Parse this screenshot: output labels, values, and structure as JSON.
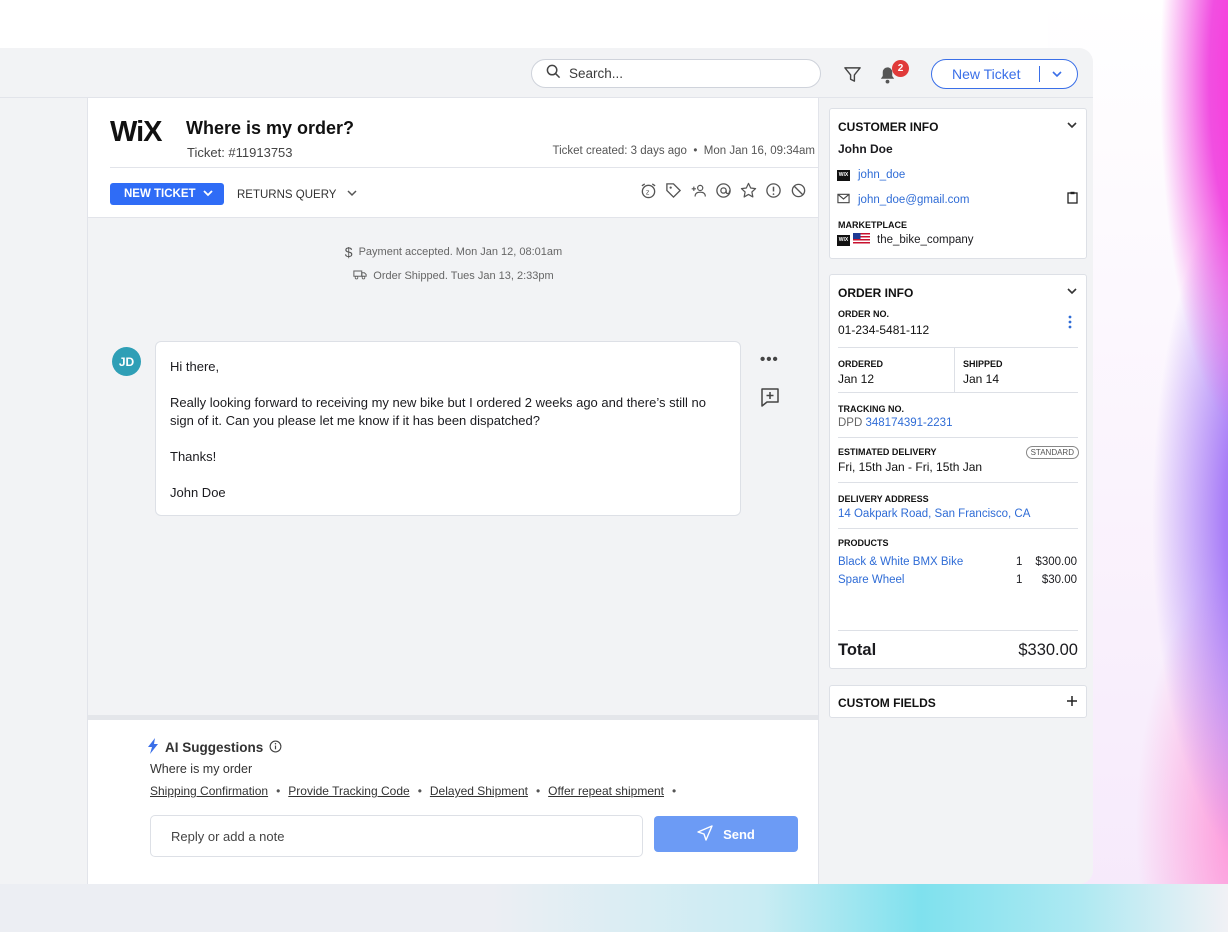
{
  "search": {
    "placeholder": "Search..."
  },
  "notifications": {
    "count": "2"
  },
  "new_ticket_button": {
    "label": "New Ticket"
  },
  "ticket": {
    "logo": "WiX",
    "title": "Where is my order?",
    "number": "Ticket: #11913753",
    "created": "Ticket created: 3 days ago  •  Mon Jan 16, 09:34am",
    "status": "NEW TICKET",
    "queue": "RETURNS QUERY"
  },
  "events": [
    {
      "icon": "dollar-icon",
      "text": "Payment accepted. Mon Jan 12, 08:01am"
    },
    {
      "icon": "truck-icon",
      "text": "Order Shipped. Tues Jan 13, 2:33pm"
    }
  ],
  "message": {
    "avatar": "JD",
    "greeting": "Hi there,",
    "body": "Really looking forward to receiving my new bike but I ordered 2 weeks ago and there’s still no sign of it. Can you please let me know if it has been dispatched?",
    "thanks": "Thanks!",
    "signature": "John Doe"
  },
  "ai": {
    "title": "AI Suggestions",
    "subtitle": "Where is my order",
    "chips": [
      "Shipping Confirmation",
      "Provide Tracking Code",
      "Delayed Shipment",
      "Offer repeat shipment"
    ]
  },
  "composer": {
    "placeholder": "Reply or add a note",
    "send_label": "Send"
  },
  "customer": {
    "heading": "CUSTOMER INFO",
    "name": "John Doe",
    "username": "john_doe",
    "email": "john_doe@gmail.com",
    "marketplace_label": "MARKETPLACE",
    "marketplace": "the_bike_company"
  },
  "order": {
    "heading": "ORDER INFO",
    "order_no_label": "ORDER NO.",
    "order_no": "01-234-5481-112",
    "ordered_label": "ORDERED",
    "ordered": "Jan 12",
    "shipped_label": "SHIPPED",
    "shipped": "Jan 14",
    "tracking_label": "TRACKING NO.",
    "carrier": "DPD",
    "tracking": "348174391-2231",
    "est_label": "ESTIMATED DELIVERY",
    "est_badge": "STANDARD",
    "est": "Fri, 15th Jan - Fri, 15th Jan",
    "address_label": "DELIVERY ADDRESS",
    "address": "14 Oakpark Road, San Francisco, CA",
    "products_label": "PRODUCTS",
    "products": [
      {
        "name": "Black & White BMX Bike",
        "qty": "1",
        "price": "$300.00"
      },
      {
        "name": "Spare Wheel",
        "qty": "1",
        "price": "$30.00"
      }
    ],
    "total_label": "Total",
    "total": "$330.00"
  },
  "custom_fields": {
    "heading": "CUSTOM FIELDS"
  },
  "colors": {
    "accent": "#2f6cf6",
    "link": "#2f6cd6",
    "badge": "#e03a3a",
    "avatar": "#2f9fb6"
  }
}
